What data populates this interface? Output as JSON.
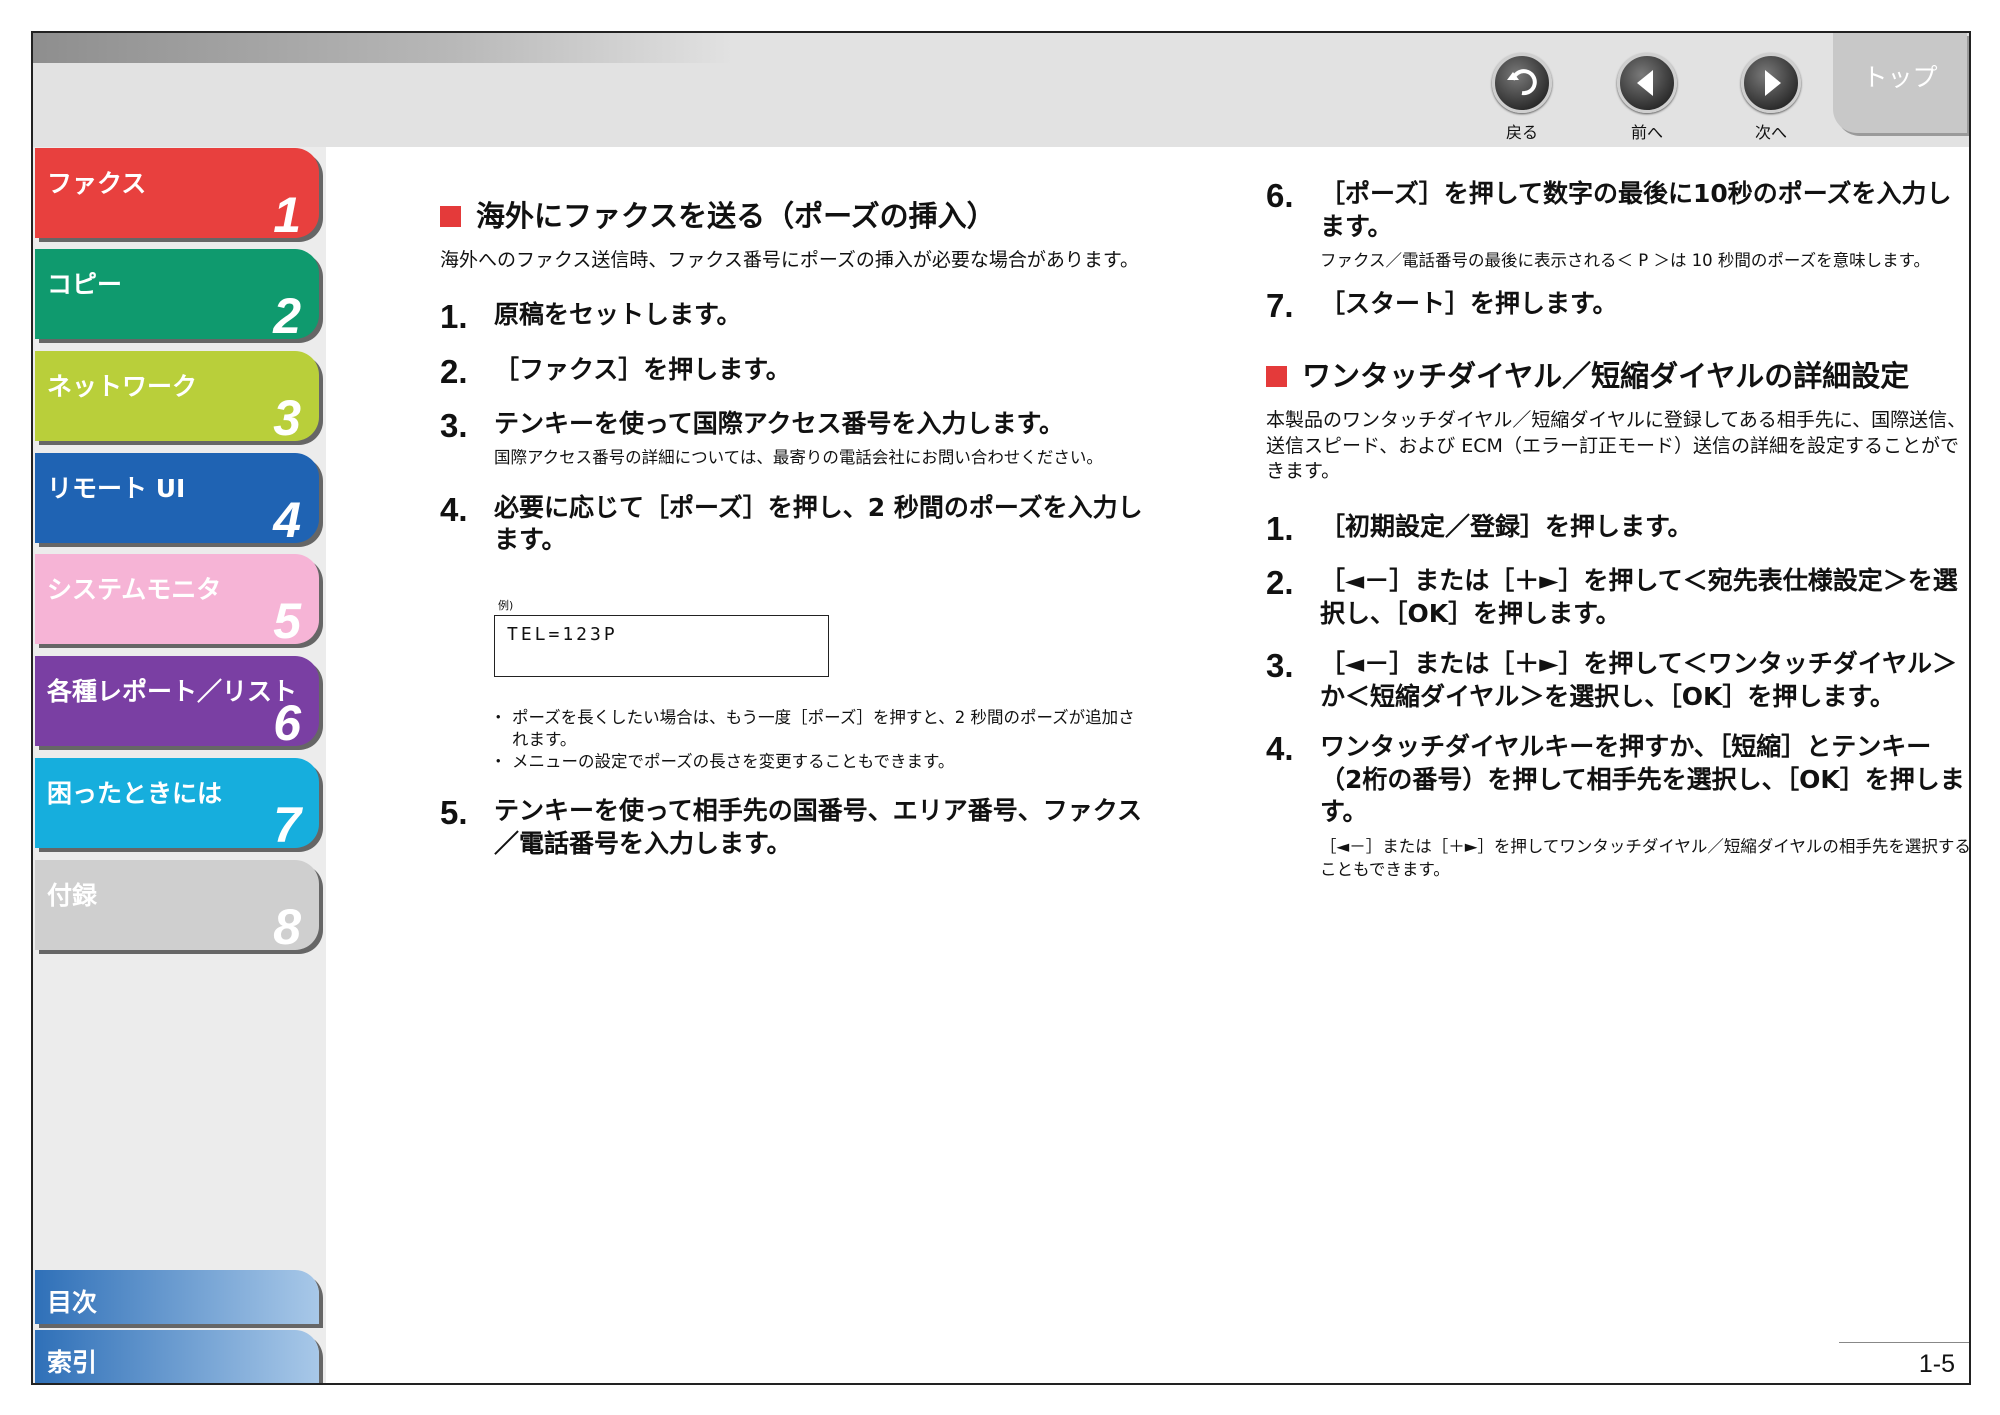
{
  "nav": {
    "back_label": "戻る",
    "prev_label": "前へ",
    "next_label": "次へ",
    "top_label": "トップ"
  },
  "sidebar": {
    "chapters": [
      {
        "label": "ファクス",
        "num": "1",
        "color": "#e8403e"
      },
      {
        "label": "コピー",
        "num": "2",
        "color": "#0f9a6e"
      },
      {
        "label": "ネットワーク",
        "num": "3",
        "color": "#b9cf3a"
      },
      {
        "label": "リモート UI",
        "num": "4",
        "color": "#1f63b3"
      },
      {
        "label": "システムモニタ",
        "num": "5",
        "color": "#f6b4d6"
      },
      {
        "label": "各種レポート／リスト",
        "num": "6",
        "color": "#7a3fa3"
      },
      {
        "label": "困ったときには",
        "num": "7",
        "color": "#16aedd"
      },
      {
        "label": "付録",
        "num": "8",
        "color": "#cfcfcf"
      }
    ],
    "toc_label": "目次",
    "index_label": "索引"
  },
  "left": {
    "heading": "海外にファクスを送る（ポーズの挿入）",
    "intro": "海外へのファクス送信時、ファクス番号にポーズの挿入が必要な場合があります。",
    "steps": [
      {
        "num": "1.",
        "text": "原稿をセットします。",
        "note": ""
      },
      {
        "num": "2.",
        "text": "［ファクス］を押します。",
        "note": ""
      },
      {
        "num": "3.",
        "text": "テンキーを使って国際アクセス番号を入力します。",
        "note": "国際アクセス番号の詳細については、最寄りの電話会社にお問い合わせください。"
      },
      {
        "num": "4.",
        "text": "必要に応じて［ポーズ］を押し、2 秒間のポーズを入力します。",
        "note": ""
      },
      {
        "num": "5.",
        "text": "テンキーを使って相手先の国番号、エリア番号、ファクス／電話番号を入力します。",
        "note": ""
      }
    ],
    "example_label": "例)",
    "example_text": "TEL=123P",
    "bullets": [
      "ポーズを長くしたい場合は、もう一度［ポーズ］を押すと、2 秒間のポーズが追加されます。",
      "メニューの設定でポーズの長さを変更することもできます。"
    ]
  },
  "right": {
    "steps_a": [
      {
        "num": "6.",
        "text": "［ポーズ］を押して数字の最後に10秒のポーズを入力します。",
        "note": "ファクス／電話番号の最後に表示される＜ P ＞は 10 秒間のポーズを意味します。"
      },
      {
        "num": "7.",
        "text": "［スタート］を押します。",
        "note": ""
      }
    ],
    "heading": "ワンタッチダイヤル／短縮ダイヤルの詳細設定",
    "intro": "本製品のワンタッチダイヤル／短縮ダイヤルに登録してある相手先に、国際送信、送信スピード、および ECM（エラー訂正モード）送信の詳細を設定することができます。",
    "steps_b": [
      {
        "num": "1.",
        "text": "［初期設定／登録］を押します。",
        "note": ""
      },
      {
        "num": "2.",
        "text": "［◄－］または［＋►］を押して＜宛先表仕様設定＞を選択し、［OK］を押します。",
        "note": ""
      },
      {
        "num": "3.",
        "text": "［◄－］または［＋►］を押して＜ワンタッチダイヤル＞か＜短縮ダイヤル＞を選択し、［OK］を押します。",
        "note": ""
      },
      {
        "num": "4.",
        "text": "ワンタッチダイヤルキーを押すか、［短縮］とテンキー（2桁の番号）を押して相手先を選択し、［OK］を押します。",
        "note": "［◄－］または［＋►］を押してワンタッチダイヤル／短縮ダイヤルの相手先を選択することもできます。"
      }
    ]
  },
  "page_number": "1-5"
}
